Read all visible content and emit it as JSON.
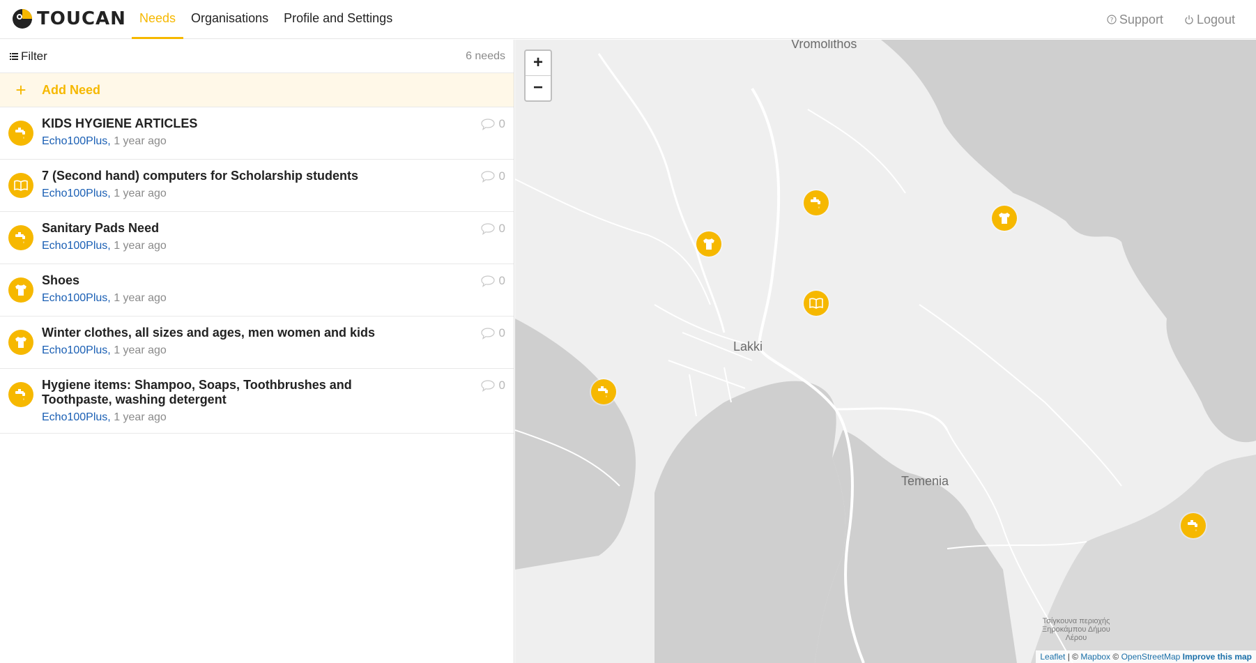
{
  "app": {
    "name": "TOUCAN"
  },
  "nav": {
    "items": [
      {
        "label": "Needs",
        "active": true
      },
      {
        "label": "Organisations",
        "active": false
      },
      {
        "label": "Profile and Settings",
        "active": false
      }
    ],
    "support": "Support",
    "logout": "Logout"
  },
  "list": {
    "filter_label": "Filter",
    "count_label": "6 needs",
    "add_label": "Add Need",
    "items": [
      {
        "title": "KIDS HYGIENE ARTICLES",
        "org": "Echo100Plus,",
        "time": "1 year ago",
        "comments": "0",
        "icon": "tap-icon"
      },
      {
        "title": "7 (Second hand) computers for Scholarship students",
        "org": "Echo100Plus,",
        "time": "1 year ago",
        "comments": "0",
        "icon": "book-icon"
      },
      {
        "title": "Sanitary Pads Need",
        "org": "Echo100Plus,",
        "time": "1 year ago",
        "comments": "0",
        "icon": "tap-icon"
      },
      {
        "title": "Shoes",
        "org": "Echo100Plus,",
        "time": "1 year ago",
        "comments": "0",
        "icon": "shirt-icon"
      },
      {
        "title": "Winter clothes, all sizes and ages, men women and kids",
        "org": "Echo100Plus,",
        "time": "1 year ago",
        "comments": "0",
        "icon": "shirt-icon"
      },
      {
        "title": "Hygiene items: Shampoo, Soaps, Toothbrushes and Toothpaste, washing detergent",
        "org": "Echo100Plus,",
        "time": "1 year ago",
        "comments": "0",
        "icon": "tap-icon"
      }
    ]
  },
  "map": {
    "zoom_in": "+",
    "zoom_out": "−",
    "labels": {
      "vromolithos": "Vromolithos",
      "lakki": "Lakki",
      "temenia": "Temenia",
      "greek_1": "Τσίγκουνα περιοχής",
      "greek_2": "Ξηροκάμπου Δήμου",
      "greek_3": "Λέρου"
    },
    "markers": [
      "tap-icon",
      "shirt-icon",
      "shirt-icon",
      "book-icon",
      "tap-icon",
      "tap-icon"
    ],
    "attribution": {
      "leaflet": "Leaflet",
      "sep1": " | © ",
      "mapbox": "Mapbox",
      "sep2": " © ",
      "osm": "OpenStreetMap",
      "improve": "Improve this map"
    }
  },
  "colors": {
    "accent": "#f6b800",
    "link": "#1a5fb4",
    "muted": "#8a8a8a",
    "water": "#cfcfcf",
    "land": "#efefef"
  }
}
